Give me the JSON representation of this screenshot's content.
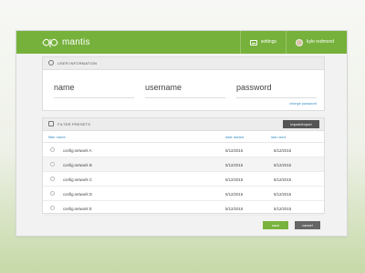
{
  "app": {
    "brand": "mantis"
  },
  "topbar": {
    "settings_label": "settings",
    "user_name": "kyle redmond"
  },
  "user_information": {
    "title": "USER INFORMATION",
    "fields": {
      "name": "name",
      "username": "username",
      "password": "password"
    },
    "change_password_link": "change password"
  },
  "filter_presets": {
    "title": "FILTER PRESETS",
    "import_export_label": "import/export",
    "columns": [
      "filter name",
      "date added",
      "last used"
    ],
    "rows": [
      {
        "name": "config.network A",
        "date_added": "5/12/2015",
        "last_used": "5/12/2015"
      },
      {
        "name": "config.network B",
        "date_added": "5/12/2015",
        "last_used": "5/12/2015"
      },
      {
        "name": "config.network C",
        "date_added": "5/12/2015",
        "last_used": "5/12/2015"
      },
      {
        "name": "config.network D",
        "date_added": "5/12/2015",
        "last_used": "5/12/2015"
      },
      {
        "name": "config.network E",
        "date_added": "5/12/2015",
        "last_used": "5/12/2015"
      }
    ]
  },
  "actions": {
    "save": "save",
    "cancel": "cancel"
  },
  "colors": {
    "accent": "#76b13b",
    "link": "#3a8fc4",
    "dark_button": "#555555"
  }
}
